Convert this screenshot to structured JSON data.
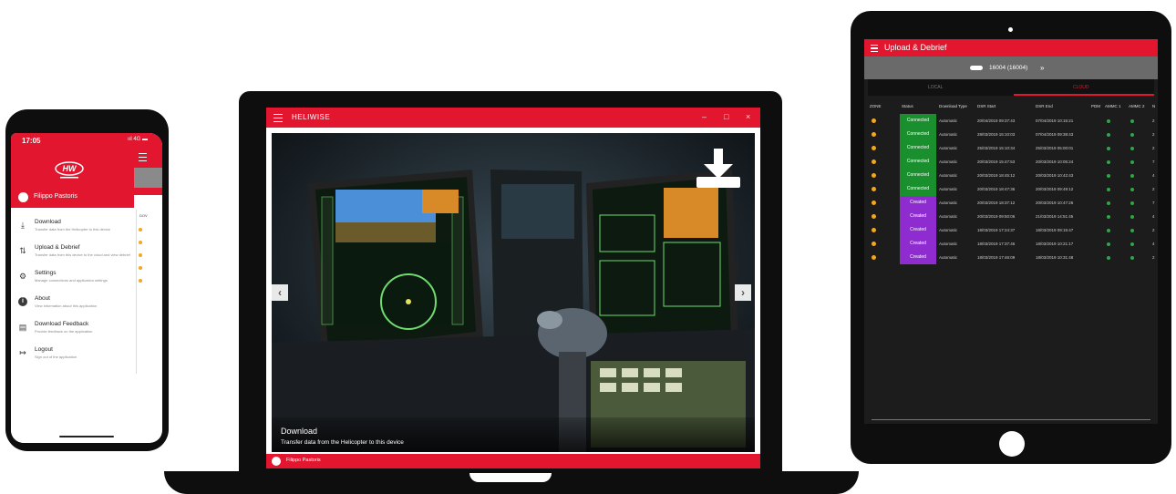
{
  "phone": {
    "time": "17:05",
    "status_icons": "ııl 4G ▬",
    "user_name": "Filippo Pastoris",
    "menu": [
      {
        "icon": "download-icon",
        "glyph": "⤓",
        "title": "Download",
        "subtitle": "Transfer data from the Helicopter to this device"
      },
      {
        "icon": "upload-debrief-icon",
        "glyph": "⇅",
        "title": "Upload & Debrief",
        "subtitle": "Transfer data from this device to the cloud and view debrief"
      },
      {
        "icon": "settings-icon",
        "glyph": "⚙",
        "title": "Settings",
        "subtitle": "Manage connections and application settings"
      },
      {
        "icon": "about-icon",
        "glyph": "i",
        "title": "About",
        "subtitle": "View information about this application"
      },
      {
        "icon": "feedback-icon",
        "glyph": "▤",
        "title": "Download Feedback",
        "subtitle": "Provide feedback on the application"
      },
      {
        "icon": "logout-icon",
        "glyph": "↦",
        "title": "Logout",
        "subtitle": "Sign out of the application"
      }
    ],
    "col_header": "DOV"
  },
  "laptop": {
    "app_title": "HELIWISE",
    "window_controls": {
      "minimize": "–",
      "maximize": "□",
      "close": "×"
    },
    "slide_title": "Download",
    "slide_subtitle": "Transfer data from the Helicopter to this device",
    "prev": "‹",
    "next": "›",
    "user_name": "Filippo Pastoris"
  },
  "tablet": {
    "app_title": "Upload & Debrief",
    "aircraft": "16004 (16004)",
    "chevron": "»",
    "tab_local": "LOCAL",
    "tab_cloud": "CLOUD",
    "columns": [
      "ZONE",
      "Status",
      "Download Type",
      "DSR Start",
      "DSR End",
      "PDM",
      "AMMC 1",
      "AMMC 2",
      "N"
    ],
    "rows": [
      {
        "status": "Connected",
        "color": "#1a8f2e",
        "type": "Automatic",
        "start": "20/04/2019 09:37:43",
        "end": "07/04/2019 10:15:21"
      },
      {
        "status": "Connected",
        "color": "#1a8f2e",
        "type": "Automatic",
        "start": "28/03/2019 15:10:03",
        "end": "07/04/2019 09:38:43"
      },
      {
        "status": "Connected",
        "color": "#1a8f2e",
        "type": "Automatic",
        "start": "25/03/2019 15:10:34",
        "end": "25/03/2019 05:00:01"
      },
      {
        "status": "Connected",
        "color": "#1a8f2e",
        "type": "Automatic",
        "start": "20/03/2019 15:47:53",
        "end": "20/03/2019 10:05:24"
      },
      {
        "status": "Connected",
        "color": "#1a8f2e",
        "type": "Automatic",
        "start": "20/03/2019 18:45:12",
        "end": "20/03/2019 10:42:43"
      },
      {
        "status": "Connected",
        "color": "#1a8f2e",
        "type": "Automatic",
        "start": "20/03/2019 18:47:36",
        "end": "20/03/2019 09:49:12"
      },
      {
        "status": "Created",
        "color": "#8e2ccf",
        "type": "Automatic",
        "start": "20/03/2019 18:37:12",
        "end": "20/03/2019 10:47:26"
      },
      {
        "status": "Created",
        "color": "#8e2ccf",
        "type": "Automatic",
        "start": "20/03/2019 09:50:06",
        "end": "21/03/2019 14:51:45"
      },
      {
        "status": "Created",
        "color": "#8e2ccf",
        "type": "Automatic",
        "start": "18/03/2019 17:24:37",
        "end": "18/03/2019 09:15:47"
      },
      {
        "status": "Created",
        "color": "#8e2ccf",
        "type": "Automatic",
        "start": "18/03/2019 17:37:46",
        "end": "18/03/2019 10:21:17"
      },
      {
        "status": "Created",
        "color": "#8e2ccf",
        "type": "Automatic",
        "start": "18/03/2019 17:46:09",
        "end": "18/03/2019 10:31:48"
      }
    ],
    "row_number": [
      "2",
      "2",
      "2",
      "7",
      "4",
      "2",
      "7",
      "4",
      "2",
      "4",
      "2"
    ]
  },
  "colors": {
    "brand_red": "#e3162f",
    "connected": "#1a8f2e",
    "created": "#8e2ccf",
    "warning": "#f3a81c",
    "ok": "#2ea843"
  }
}
